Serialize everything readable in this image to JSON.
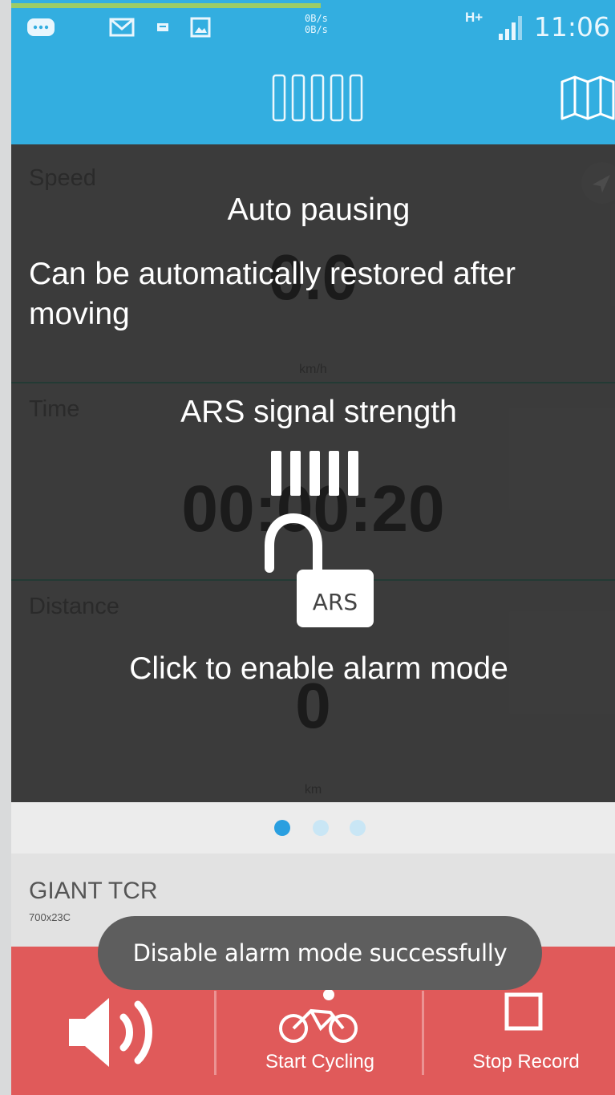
{
  "status_bar": {
    "net_speed_up": "0B/s",
    "net_speed_down": "0B/s",
    "network_type": "H+",
    "time": "11:06",
    "icons": [
      "chat-icon",
      "mail-icon",
      "sms-icon",
      "image-icon",
      "signal-icon"
    ]
  },
  "app_bar": {
    "signal_bars": 5,
    "map_button": "map-icon"
  },
  "metrics": {
    "speed": {
      "label": "Speed",
      "value": "0.0",
      "unit": "km/h"
    },
    "time": {
      "label": "Time",
      "value": "00:00:20"
    },
    "distance": {
      "label": "Distance",
      "value": "0",
      "unit": "km"
    }
  },
  "overlay": {
    "auto_pause_title": "Auto pausing",
    "auto_pause_desc_line1": "Can be automatically restored after",
    "auto_pause_desc_line2": "moving",
    "ars_title": "ARS signal strength",
    "ars_badge": "ARS",
    "alarm_hint": "Click to enable alarm mode"
  },
  "pager": {
    "count": 3,
    "active": 0
  },
  "bike": {
    "name": "GIANT TCR",
    "tire": "700x23C"
  },
  "bottom_bar": {
    "start_label": "Start Cycling",
    "stop_label": "Stop Record"
  },
  "toast": {
    "message": "Disable alarm mode successfully"
  },
  "colors": {
    "primary": "#33aee0",
    "accent_red": "#e05a5a",
    "panel": "#4c4c4c",
    "dot_active": "#2a9fe0",
    "dot_inactive": "#c9e6f5"
  }
}
